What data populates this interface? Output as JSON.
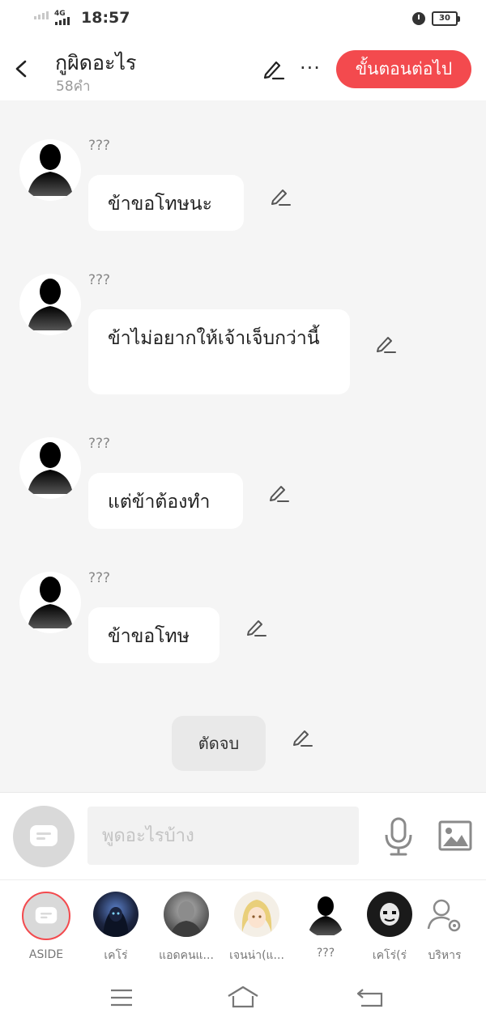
{
  "status_bar": {
    "network": "4G",
    "time": "18:57",
    "battery": "30"
  },
  "header": {
    "title": "กูผิดอะไร",
    "subtitle": "58คำ",
    "more_label": "···",
    "next_label": "ขั้นตอนต่อไป"
  },
  "messages": [
    {
      "name": "???",
      "text": "ข้าขอโทษนะ"
    },
    {
      "name": "???",
      "text": "ข้าไม่อยากให้เจ้าเจ็บกว่านี้"
    },
    {
      "name": "???",
      "text": "แต่ข้าต้องทำ"
    },
    {
      "name": "???",
      "text": "ข้าขอโทษ"
    }
  ],
  "end_label": "ตัดจบ",
  "input": {
    "placeholder": "พูดอะไรบ้าง"
  },
  "characters": [
    {
      "label": "ASIDE"
    },
    {
      "label": "เคโร่"
    },
    {
      "label": "แอดคนแ..."
    },
    {
      "label": "เจนน่า(แ..."
    },
    {
      "label": "???"
    },
    {
      "label": "เคโร่(ร่"
    },
    {
      "label": "บริหาร"
    }
  ],
  "colors": {
    "accent": "#f34a4e",
    "chat_bg": "#f5f5f5"
  }
}
